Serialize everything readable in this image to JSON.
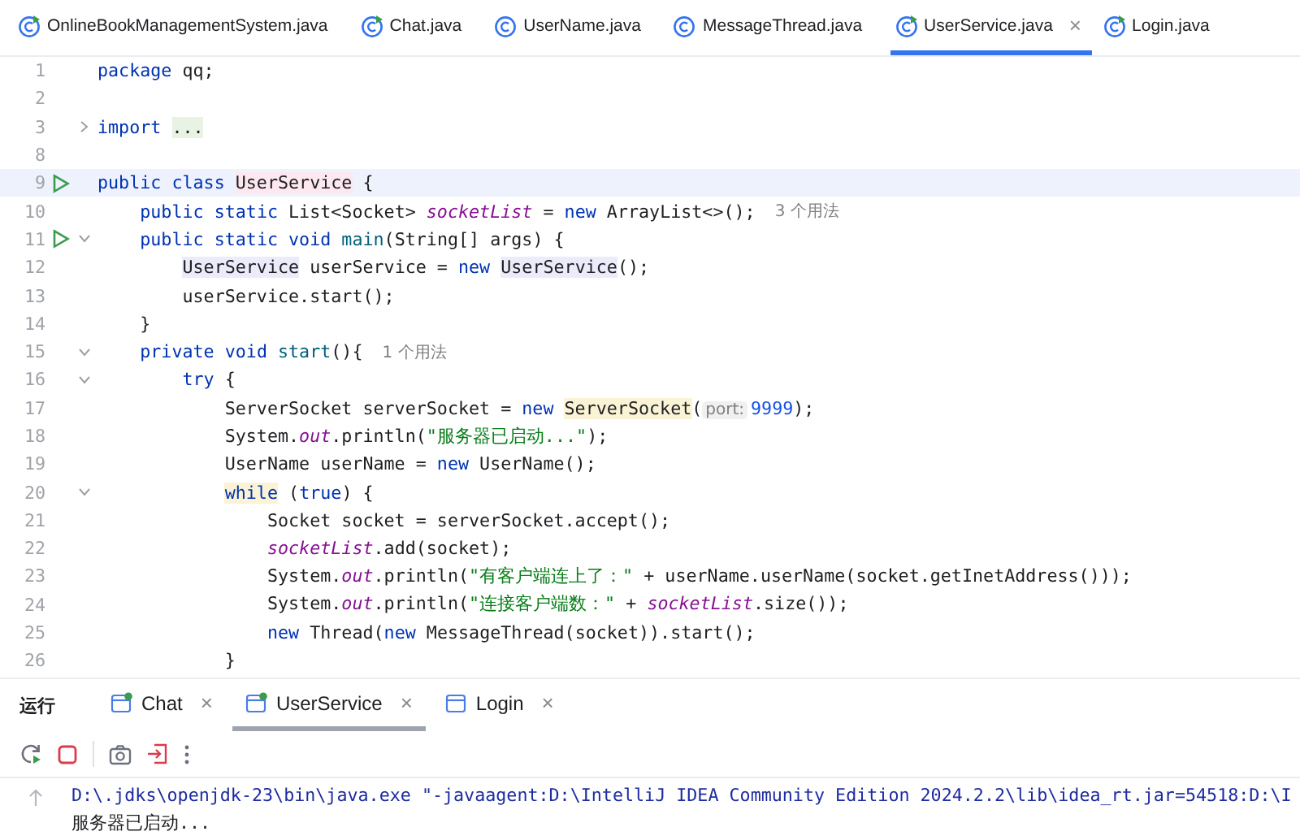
{
  "editor_tabs": [
    {
      "label": "OnlineBookManagementSystem.java",
      "runnable": true,
      "selected": false
    },
    {
      "label": "Chat.java",
      "runnable": true,
      "selected": false
    },
    {
      "label": "UserName.java",
      "runnable": false,
      "selected": false
    },
    {
      "label": "MessageThread.java",
      "runnable": false,
      "selected": false
    },
    {
      "label": "UserService.java",
      "runnable": true,
      "selected": true,
      "close": "×"
    },
    {
      "label": "Login.java",
      "runnable": true,
      "selected": false
    }
  ],
  "code_lines": [
    {
      "number": "1",
      "run": false,
      "current": false,
      "tokens": [
        {
          "text": "package",
          "kind": "keyword"
        },
        {
          "text": " qq;",
          "kind": "plain"
        }
      ]
    },
    {
      "number": "2",
      "run": false,
      "current": false
    },
    {
      "number": "3",
      "run": false,
      "current": false,
      "collapsed": true,
      "tokens": [
        {
          "text": "import",
          "kind": "keyword"
        },
        {
          "text": " ...",
          "kind": "folded"
        }
      ]
    },
    {
      "number": "8",
      "run": false,
      "current": false
    },
    {
      "number": "9",
      "run": true,
      "current": true,
      "tokens": [
        {
          "text": "public class",
          "kind": "keyword"
        },
        {
          "text": " UserService",
          "kind": "declaration"
        },
        {
          "text": " {",
          "kind": "plain"
        }
      ]
    },
    {
      "number": "10",
      "run": false,
      "current": false,
      "tokens": [
        {
          "text": "    public static",
          "kind": "keyword"
        },
        {
          "text": " List<Socket> ",
          "kind": "plain"
        },
        {
          "text": "socketList",
          "kind": "static_field"
        },
        {
          "text": " = ",
          "kind": "plain"
        },
        {
          "text": "new",
          "kind": "keyword"
        },
        {
          "text": " ArrayList<>();",
          "kind": "plain"
        }
      ],
      "usages": "3 个用法"
    },
    {
      "number": "11",
      "run": true,
      "current": false,
      "collapsed": false,
      "tokens": [
        {
          "text": "    public static void",
          "kind": "keyword"
        },
        {
          "text": " main",
          "kind": "method"
        },
        {
          "text": "(String[] args) {",
          "kind": "plain"
        }
      ]
    },
    {
      "number": "12",
      "run": false,
      "current": false,
      "tokens": [
        {
          "text": "        UserService",
          "kind": "reference"
        },
        {
          "text": " userService = ",
          "kind": "plain"
        },
        {
          "text": "new",
          "kind": "keyword"
        },
        {
          "text": " UserService",
          "kind": "reference"
        },
        {
          "text": "();",
          "kind": "plain"
        }
      ]
    },
    {
      "number": "13",
      "run": false,
      "current": false,
      "tokens": [
        {
          "text": "        userService.start();",
          "kind": "plain"
        }
      ]
    },
    {
      "number": "14",
      "run": false,
      "current": false,
      "tokens": [
        {
          "text": "    }",
          "kind": "plain"
        }
      ]
    },
    {
      "number": "15",
      "run": false,
      "current": false,
      "collapsed": false,
      "tokens": [
        {
          "text": "    private void",
          "kind": "keyword"
        },
        {
          "text": " start",
          "kind": "method"
        },
        {
          "text": "(){",
          "kind": "plain"
        }
      ],
      "usages": "1 个用法"
    },
    {
      "number": "16",
      "run": false,
      "current": false,
      "collapsed": false,
      "tokens": [
        {
          "text": "        try",
          "kind": "keyword"
        },
        {
          "text": " {",
          "kind": "plain"
        }
      ]
    },
    {
      "number": "17",
      "run": false,
      "current": false,
      "tokens": [
        {
          "text": "            ServerSocket serverSocket = ",
          "kind": "plain"
        },
        {
          "text": "new",
          "kind": "keyword"
        },
        {
          "text": " ServerSocket",
          "kind": "constructor"
        },
        {
          "text": "(",
          "kind": "plain"
        },
        {
          "text": "port:",
          "kind": "hint"
        },
        {
          "text": "9999",
          "kind": "number"
        },
        {
          "text": ");",
          "kind": "plain"
        }
      ]
    },
    {
      "number": "18",
      "run": false,
      "current": false,
      "tokens": [
        {
          "text": "            System.",
          "kind": "plain"
        },
        {
          "text": "out",
          "kind": "static_field"
        },
        {
          "text": ".println(",
          "kind": "plain"
        },
        {
          "text": "\"服务器已启动...\"",
          "kind": "string"
        },
        {
          "text": ");",
          "kind": "plain"
        }
      ]
    },
    {
      "number": "19",
      "run": false,
      "current": false,
      "tokens": [
        {
          "text": "            UserName userName = ",
          "kind": "plain"
        },
        {
          "text": "new",
          "kind": "keyword"
        },
        {
          "text": " UserName();",
          "kind": "plain"
        }
      ]
    },
    {
      "number": "20",
      "run": false,
      "current": false,
      "collapsed": false,
      "tokens": [
        {
          "text": "            while",
          "kind": "keyword_match"
        },
        {
          "text": " (",
          "kind": "plain"
        },
        {
          "text": "true",
          "kind": "keyword"
        },
        {
          "text": ") {",
          "kind": "plain"
        }
      ]
    },
    {
      "number": "21",
      "run": false,
      "current": false,
      "tokens": [
        {
          "text": "                Socket socket = serverSocket.accept();",
          "kind": "plain"
        }
      ]
    },
    {
      "number": "22",
      "run": false,
      "current": false,
      "tokens": [
        {
          "text": "                socketList",
          "kind": "static_field"
        },
        {
          "text": ".add(socket);",
          "kind": "plain"
        }
      ]
    },
    {
      "number": "23",
      "run": false,
      "current": false,
      "tokens": [
        {
          "text": "                System.",
          "kind": "plain"
        },
        {
          "text": "out",
          "kind": "static_field"
        },
        {
          "text": ".println(",
          "kind": "plain"
        },
        {
          "text": "\"有客户端连上了：\"",
          "kind": "string"
        },
        {
          "text": " + userName.userName(socket.getInetAddress()));",
          "kind": "plain"
        }
      ]
    },
    {
      "number": "24",
      "run": false,
      "current": false,
      "tokens": [
        {
          "text": "                System.",
          "kind": "plain"
        },
        {
          "text": "out",
          "kind": "static_field"
        },
        {
          "text": ".println(",
          "kind": "plain"
        },
        {
          "text": "\"连接客户端数：\"",
          "kind": "string"
        },
        {
          "text": " + ",
          "kind": "plain"
        },
        {
          "text": "socketList",
          "kind": "static_field"
        },
        {
          "text": ".size());",
          "kind": "plain"
        }
      ]
    },
    {
      "number": "25",
      "run": false,
      "current": false,
      "tokens": [
        {
          "text": "                new",
          "kind": "keyword"
        },
        {
          "text": " Thread(",
          "kind": "plain"
        },
        {
          "text": "new",
          "kind": "keyword"
        },
        {
          "text": " MessageThread(socket)).start();",
          "kind": "plain"
        }
      ]
    },
    {
      "number": "26",
      "run": false,
      "current": false,
      "tokens": [
        {
          "text": "            }",
          "kind": "plain"
        }
      ]
    }
  ],
  "run_panel": {
    "title": "运行",
    "tabs": [
      {
        "label": "Chat",
        "running": true,
        "selected": false,
        "close": "×"
      },
      {
        "label": "UserService",
        "running": true,
        "selected": true,
        "close": "×"
      },
      {
        "label": "Login",
        "running": false,
        "selected": false,
        "close": "×"
      }
    ],
    "console": [
      {
        "text": "D:\\.jdks\\openjdk-23\\bin\\java.exe \"-javaagent:D:\\IntelliJ IDEA Community Edition 2024.2.2\\lib\\idea_rt.jar=54518:D:\\I",
        "kind": "command"
      },
      {
        "text": "服务器已启动...",
        "kind": "output"
      }
    ]
  }
}
